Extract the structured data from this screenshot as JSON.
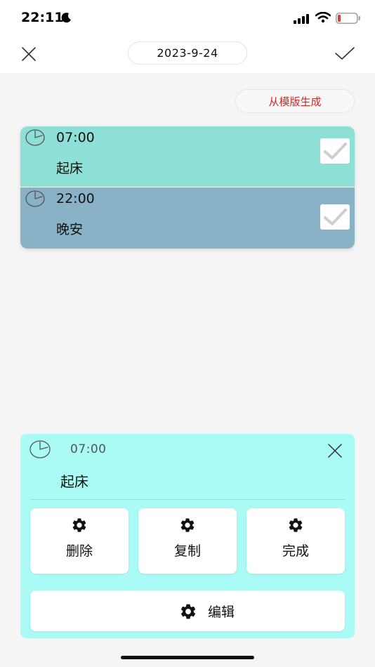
{
  "status_bar": {
    "time": "22:11",
    "icons": [
      "moon-icon",
      "signal-icon",
      "wifi-icon",
      "battery-icon"
    ],
    "battery_color": "#e53935"
  },
  "nav": {
    "date": "2023-9-24",
    "close_icon": "close-icon",
    "confirm_icon": "check-icon"
  },
  "template_button": {
    "label": "从模版生成",
    "color": "#d12a2a"
  },
  "tasks": [
    {
      "time": "07:00",
      "title": "起床",
      "color": "#8ee0d6",
      "checked": false
    },
    {
      "time": "22:00",
      "title": "晚安",
      "color": "#89b2c6",
      "checked": false
    }
  ],
  "detail": {
    "time": "07:00",
    "title": "起床",
    "background": "#aafaf6",
    "actions": [
      {
        "label": "删除",
        "icon": "gear-icon"
      },
      {
        "label": "复制",
        "icon": "gear-icon"
      },
      {
        "label": "完成",
        "icon": "gear-icon"
      }
    ],
    "edit": {
      "label": "编辑",
      "icon": "gear-icon"
    }
  }
}
